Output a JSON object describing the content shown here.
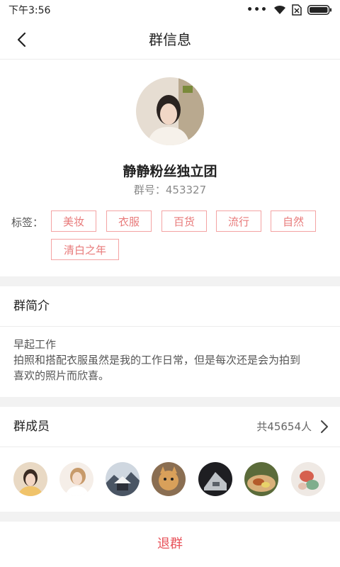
{
  "status_bar": {
    "time": "下午3:56",
    "more": "•••"
  },
  "nav": {
    "title": "群信息"
  },
  "profile": {
    "name": "静静粉丝独立团",
    "number_label": "群号：",
    "number": "453327",
    "tags_label": "标签：",
    "tags": [
      "美妆",
      "衣服",
      "百货",
      "流行",
      "自然",
      "清白之年"
    ]
  },
  "intro": {
    "title": "群简介",
    "line1": "早起工作",
    "line2": "拍照和搭配衣服虽然是我的工作日常，但是每次还是会为拍到",
    "line3": "喜欢的照片而欣喜。"
  },
  "members": {
    "title": "群成员",
    "count": "共45654人"
  },
  "quit_label": "退群",
  "colors": {
    "accent": "#e8525a",
    "tag_border": "#f4a3a3",
    "tag_text": "#e87a7a"
  }
}
